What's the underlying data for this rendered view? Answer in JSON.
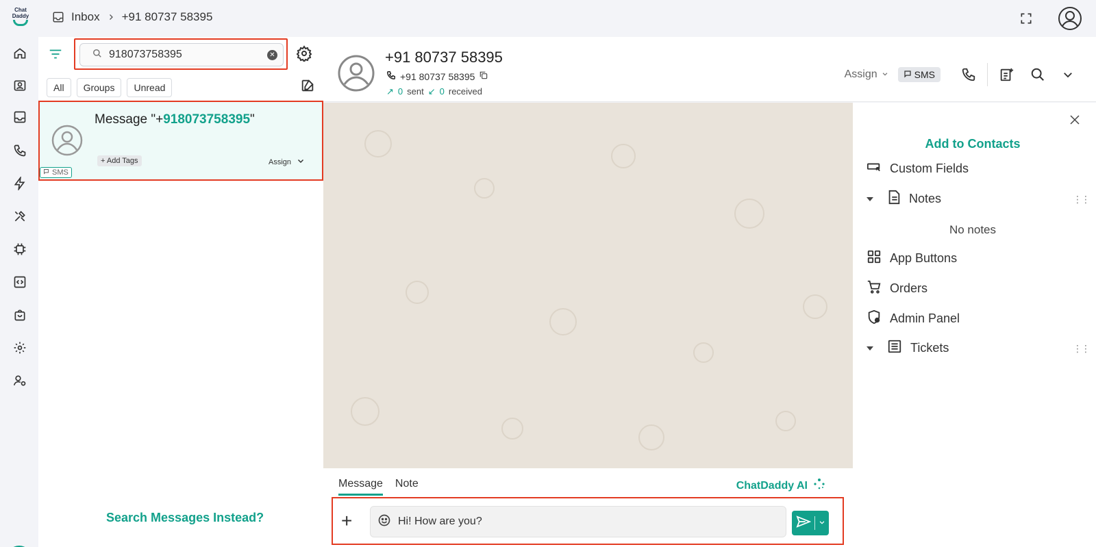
{
  "logo": {
    "line1": "Chat",
    "line2": "Daddy"
  },
  "breadcrumb": {
    "root": "Inbox",
    "current": "+91 80737 58395"
  },
  "search": {
    "value": "918073758395",
    "placeholder": "Search"
  },
  "list_tabs": [
    "All",
    "Groups",
    "Unread"
  ],
  "conversation": {
    "title_prefix": "Message \"+",
    "title_highlight": "918073758395",
    "title_suffix": "\"",
    "add_tags": "+ Add Tags",
    "assign": "Assign",
    "channel": "SMS"
  },
  "search_messages": "Search Messages Instead?",
  "chat_header": {
    "name": "+91 80737 58395",
    "phone": "+91 80737 58395",
    "sent_count": "0",
    "sent_label": "sent",
    "received_count": "0",
    "received_label": "received",
    "assign": "Assign",
    "channel": "SMS"
  },
  "composer": {
    "tabs": [
      "Message",
      "Note"
    ],
    "ai_label": "ChatDaddy AI",
    "input_value": "Hi! How are you?"
  },
  "right_panel": {
    "add_contacts": "Add to Contacts",
    "custom_fields": "Custom Fields",
    "notes": "Notes",
    "no_notes": "No notes",
    "app_buttons": "App Buttons",
    "orders": "Orders",
    "admin_panel": "Admin Panel",
    "tickets": "Tickets"
  },
  "colors": {
    "accent": "#12a18b",
    "highlight_box": "#e33b22",
    "chat_bg": "#e9e3da"
  },
  "rail_icons": [
    "home-icon",
    "contacts-icon",
    "inbox-icon",
    "phone-icon",
    "automation-icon",
    "tools-icon",
    "chip-icon",
    "code-icon",
    "shop-icon",
    "settings-icon",
    "team-icon",
    "help-icon"
  ]
}
